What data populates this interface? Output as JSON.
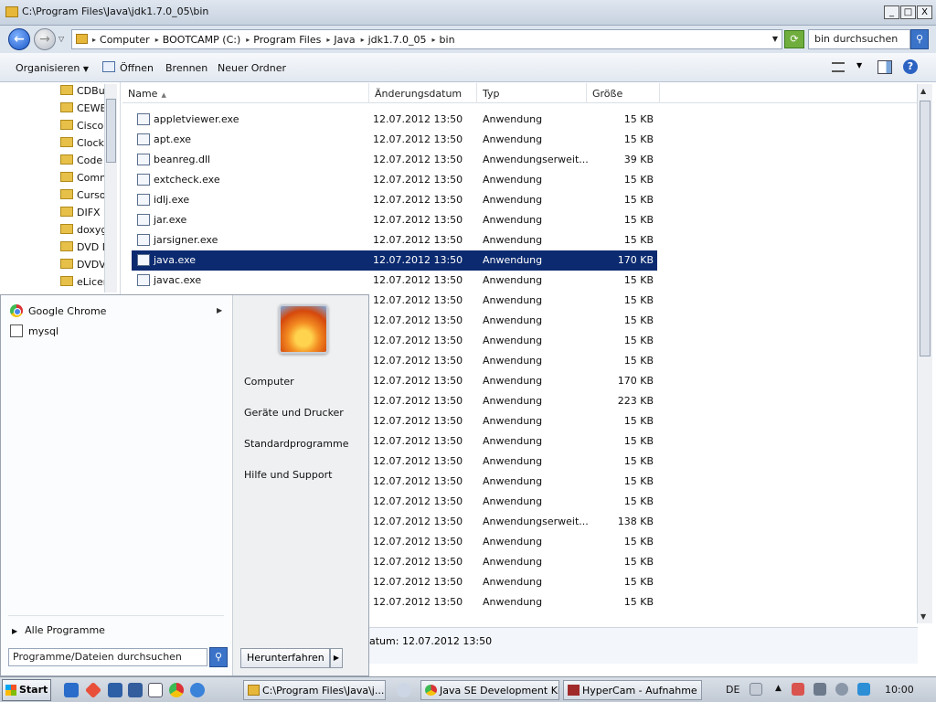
{
  "window": {
    "title": "C:\\Program Files\\Java\\jdk1.7.0_05\\bin",
    "controls": [
      "_",
      "□",
      "X"
    ]
  },
  "address": {
    "crumbs": [
      "Computer",
      "BOOTCAMP (C:)",
      "Program Files",
      "Java",
      "jdk1.7.0_05",
      "bin"
    ],
    "search_placeholder": "bin durchsuchen"
  },
  "toolbar": {
    "organize": "Organisieren",
    "open": "Öffnen",
    "burn": "Brennen",
    "new_folder": "Neuer Ordner"
  },
  "navpane": {
    "items": [
      "CDBu",
      "CEWE",
      "Cisco",
      "Clock",
      "Code",
      "Comm",
      "Curso",
      "DIFX",
      "doxyg",
      "DVD N",
      "DVDV",
      "eLicen"
    ]
  },
  "columns": {
    "name": "Name",
    "date": "Änderungsdatum",
    "type": "Typ",
    "size": "Größe"
  },
  "files": [
    {
      "name": "appletviewer.exe",
      "date": "12.07.2012 13:50",
      "type": "Anwendung",
      "size": "15 KB"
    },
    {
      "name": "apt.exe",
      "date": "12.07.2012 13:50",
      "type": "Anwendung",
      "size": "15 KB"
    },
    {
      "name": "beanreg.dll",
      "date": "12.07.2012 13:50",
      "type": "Anwendungserweit...",
      "size": "39 KB"
    },
    {
      "name": "extcheck.exe",
      "date": "12.07.2012 13:50",
      "type": "Anwendung",
      "size": "15 KB"
    },
    {
      "name": "idlj.exe",
      "date": "12.07.2012 13:50",
      "type": "Anwendung",
      "size": "15 KB"
    },
    {
      "name": "jar.exe",
      "date": "12.07.2012 13:50",
      "type": "Anwendung",
      "size": "15 KB"
    },
    {
      "name": "jarsigner.exe",
      "date": "12.07.2012 13:50",
      "type": "Anwendung",
      "size": "15 KB"
    },
    {
      "name": "java.exe",
      "date": "12.07.2012 13:50",
      "type": "Anwendung",
      "size": "170 KB",
      "selected": true
    },
    {
      "name": "javac.exe",
      "date": "12.07.2012 13:50",
      "type": "Anwendung",
      "size": "15 KB"
    },
    {
      "name": "",
      "date": "12.07.2012 13:50",
      "type": "Anwendung",
      "size": "15 KB"
    },
    {
      "name": "",
      "date": "12.07.2012 13:50",
      "type": "Anwendung",
      "size": "15 KB"
    },
    {
      "name": "",
      "date": "12.07.2012 13:50",
      "type": "Anwendung",
      "size": "15 KB"
    },
    {
      "name": "",
      "date": "12.07.2012 13:50",
      "type": "Anwendung",
      "size": "15 KB"
    },
    {
      "name": "",
      "date": "12.07.2012 13:50",
      "type": "Anwendung",
      "size": "170 KB"
    },
    {
      "name": "",
      "date": "12.07.2012 13:50",
      "type": "Anwendung",
      "size": "223 KB"
    },
    {
      "name": "",
      "date": "12.07.2012 13:50",
      "type": "Anwendung",
      "size": "15 KB"
    },
    {
      "name": "",
      "date": "12.07.2012 13:50",
      "type": "Anwendung",
      "size": "15 KB"
    },
    {
      "name": "",
      "date": "12.07.2012 13:50",
      "type": "Anwendung",
      "size": "15 KB"
    },
    {
      "name": "",
      "date": "12.07.2012 13:50",
      "type": "Anwendung",
      "size": "15 KB"
    },
    {
      "name": "",
      "date": "12.07.2012 13:50",
      "type": "Anwendung",
      "size": "15 KB"
    },
    {
      "name": "",
      "date": "12.07.2012 13:50",
      "type": "Anwendungserweit...",
      "size": "138 KB"
    },
    {
      "name": "",
      "date": "12.07.2012 13:50",
      "type": "Anwendung",
      "size": "15 KB"
    },
    {
      "name": "",
      "date": "12.07.2012 13:50",
      "type": "Anwendung",
      "size": "15 KB"
    },
    {
      "name": "",
      "date": "12.07.2012 13:50",
      "type": "Anwendung",
      "size": "15 KB"
    },
    {
      "name": "",
      "date": "12.07.2012 13:50",
      "type": "Anwendung",
      "size": "15 KB"
    }
  ],
  "details": {
    "text": "atum: 12.07.2012 13:50"
  },
  "startmenu": {
    "programs": [
      "Google Chrome",
      "mysql"
    ],
    "all_programs": "Alle Programme",
    "search_placeholder": "Programme/Dateien durchsuchen",
    "links": [
      "Computer",
      "Geräte und Drucker",
      "Standardprogramme",
      "Hilfe und Support"
    ],
    "shutdown": "Herunterfahren"
  },
  "taskbar": {
    "start": "Start",
    "tasks": [
      "C:\\Program Files\\Java\\j...",
      "Java SE Development Ki...",
      "HyperCam - Aufnahme"
    ],
    "lang": "DE",
    "clock": "10:00"
  }
}
